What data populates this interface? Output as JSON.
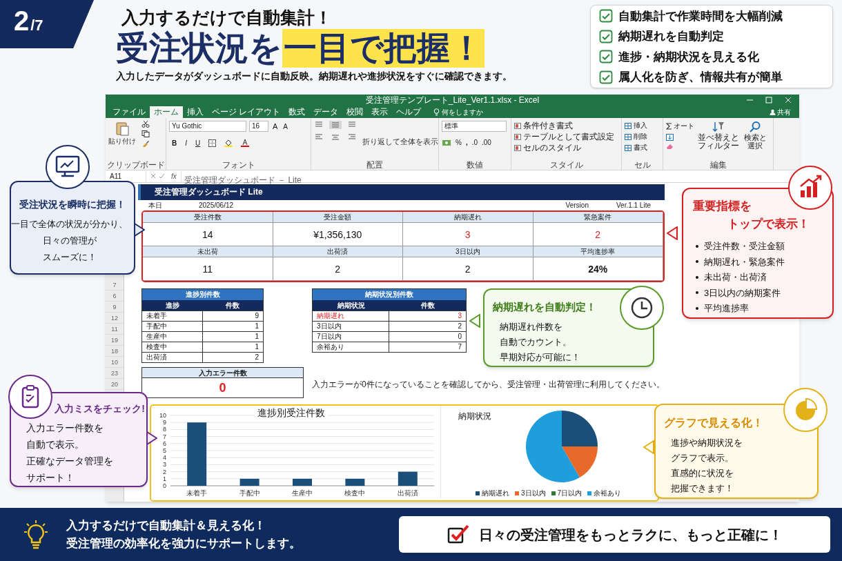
{
  "page_badge": {
    "number": "2",
    "total": "/7"
  },
  "header": {
    "kicker": "入力するだけで自動集計！",
    "headline": "受注状況を",
    "headline_highlight": "一目で把握！",
    "subtitle": "入力したデータがダッシュボードに自動反映。納期遅れや進捗状況をすぐに確認できます。"
  },
  "feature_checklist": [
    {
      "label": "自動集計で作業時間を大幅削減",
      "checked": true
    },
    {
      "label": "納期遅れを自動判定",
      "checked": true
    },
    {
      "label": "進捗・納期状況を見える化",
      "checked": true
    },
    {
      "label": "属人化を防ぎ、情報共有が簡単",
      "checked": true
    }
  ],
  "excel": {
    "title": "受注管理テンプレート_Lite_Ver1.1.xlsx  -  Excel",
    "menu_tabs": [
      {
        "label": "ファイル",
        "selected": false
      },
      {
        "label": "ホーム",
        "selected": true
      },
      {
        "label": "挿入",
        "selected": false
      },
      {
        "label": "ページ レイアウト",
        "selected": false
      },
      {
        "label": "数式",
        "selected": false
      },
      {
        "label": "データ",
        "selected": false
      },
      {
        "label": "校閲",
        "selected": false
      },
      {
        "label": "表示",
        "selected": false
      },
      {
        "label": "ヘルプ",
        "selected": false
      }
    ],
    "tell_me": "何をしますか",
    "share": "共有",
    "ribbon": {
      "paste": "貼り付け",
      "font_name": "Yu Gothic",
      "font_size": "16",
      "size_buttons": [
        "A",
        "A"
      ],
      "font_buttons": [
        "B",
        "I",
        "U"
      ],
      "wrap": "折り返して全体を表示",
      "number_format": "標準",
      "percent": "%",
      "comma": ",",
      "decimal_buttons": [
        ".0",
        ".00"
      ],
      "styles": [
        "条件付き書式",
        "テーブルとして書式設定",
        "セルのスタイル"
      ],
      "cells": [
        "挿入",
        "削除",
        "書式"
      ],
      "sum": "オート",
      "sort": "並べ替えとフィルター",
      "find": "検索と選択",
      "groups": [
        "クリップボード",
        "フォント",
        "配置",
        "数値",
        "スタイル",
        "セル",
        "編集"
      ]
    },
    "name_box": "A11",
    "fx": "fx",
    "formula": "受注管理ダッシュボード － Lite",
    "row_numbers": [
      "7",
      "6",
      "9",
      "12",
      "11",
      "19",
      "18",
      "10",
      "23",
      "20"
    ]
  },
  "dashboard": {
    "title": "受注管理ダッシュボード Lite",
    "date_label": "本日",
    "date": "2025/06/12",
    "version_label": "Version",
    "version": "Ver.1.1 Lite",
    "kpis": [
      {
        "label": "受注件数",
        "value": "14",
        "alert": false
      },
      {
        "label": "受注金額",
        "value": "¥1,356,130",
        "alert": false
      },
      {
        "label": "納期遅れ",
        "value": "3",
        "alert": true
      },
      {
        "label": "緊急案件",
        "value": "2",
        "alert": true
      },
      {
        "label": "未出荷",
        "value": "11",
        "alert": false
      },
      {
        "label": "出荷済",
        "value": "2",
        "alert": false
      },
      {
        "label": "3日以内",
        "value": "2",
        "alert": false
      },
      {
        "label": "平均進捗率",
        "value": "24%",
        "alert": false
      }
    ],
    "progress_table": {
      "title": "進捗別件数",
      "columns": [
        "進捗",
        "件数"
      ],
      "rows": [
        {
          "cells": [
            "未着手",
            "9"
          ],
          "alert": false
        },
        {
          "cells": [
            "手配中",
            "1"
          ],
          "alert": false
        },
        {
          "cells": [
            "生産中",
            "1"
          ],
          "alert": false
        },
        {
          "cells": [
            "検査中",
            "1"
          ],
          "alert": false
        },
        {
          "cells": [
            "出荷済",
            "2"
          ],
          "alert": false
        }
      ]
    },
    "delivery_table": {
      "title": "納期状況別件数",
      "columns": [
        "納期状況",
        "件数"
      ],
      "rows": [
        {
          "cells": [
            "納期遅れ",
            "3"
          ],
          "alert": true
        },
        {
          "cells": [
            "3日以内",
            "2"
          ],
          "alert": false
        },
        {
          "cells": [
            "7日以内",
            "0"
          ],
          "alert": false
        },
        {
          "cells": [
            "余裕あり",
            "7"
          ],
          "alert": false
        }
      ]
    },
    "error_box": {
      "label": "入力エラー件数",
      "value": "0"
    },
    "note": "入力エラーが0件になっていることを確認してから、受注管理・出荷管理に利用してください。",
    "bar_chart": {
      "chart_data": {
        "type": "bar",
        "title": "進捗別受注件数",
        "categories": [
          "未着手",
          "手配中",
          "生産中",
          "検査中",
          "出荷済"
        ],
        "values": [
          9,
          1,
          1,
          1,
          2
        ],
        "ylim": [
          0,
          10
        ],
        "yticks": [
          0,
          1,
          2,
          3,
          4,
          5,
          6,
          7,
          8,
          9,
          10
        ],
        "grid": true
      }
    },
    "pie_chart": {
      "chart_data": {
        "type": "pie",
        "title": "納期状況",
        "categories": [
          "納期遅れ",
          "3日以内",
          "7日以内",
          "余裕あり"
        ],
        "values": [
          25,
          16.7,
          0,
          58.3
        ],
        "legend": "bottom"
      },
      "slices": [
        {
          "color": "#1b4f7a"
        },
        {
          "color": "#e8692a"
        },
        {
          "color": "#2e7d32"
        },
        {
          "color": "#1e9fdc"
        }
      ]
    }
  },
  "callouts": [
    {
      "kind": "overview",
      "title": [
        "受注状況を瞬時に把握！"
      ],
      "body": [
        "一目で全体の状況が分かり、",
        "日々の管理が",
        "スムーズに！"
      ]
    },
    {
      "kind": "kpi",
      "title": [
        "重要指標を",
        "トップで表示！"
      ],
      "bullets": [
        "受注件数・受注金額",
        "納期遅れ・緊急案件",
        "未出荷・出荷済",
        "3日以内の納期案件",
        "平均進捗率"
      ]
    },
    {
      "kind": "delivery",
      "title": [
        "納期遅れを自動判定！"
      ],
      "body": [
        "納期遅れ件数を",
        "自動でカウント。",
        "早期対応が可能に！"
      ]
    },
    {
      "kind": "error",
      "title": [
        "入力ミスをチェック!"
      ],
      "body": [
        "入力エラー件数を",
        "自動で表示。",
        "正確なデータ管理を",
        "サポート！"
      ]
    },
    {
      "kind": "graph",
      "title": [
        "グラフで見える化！"
      ],
      "body": [
        "進捗や納期状況を",
        "グラフで表示。",
        "直感的に状況を",
        "把握できます！"
      ]
    }
  ],
  "footer": {
    "lines": [
      "入力するだけで自動集計＆見える化！",
      "受注管理の効率化を強力にサポートします。"
    ],
    "banner": "日々の受注管理をもっとラクに、もっと正確に！"
  }
}
